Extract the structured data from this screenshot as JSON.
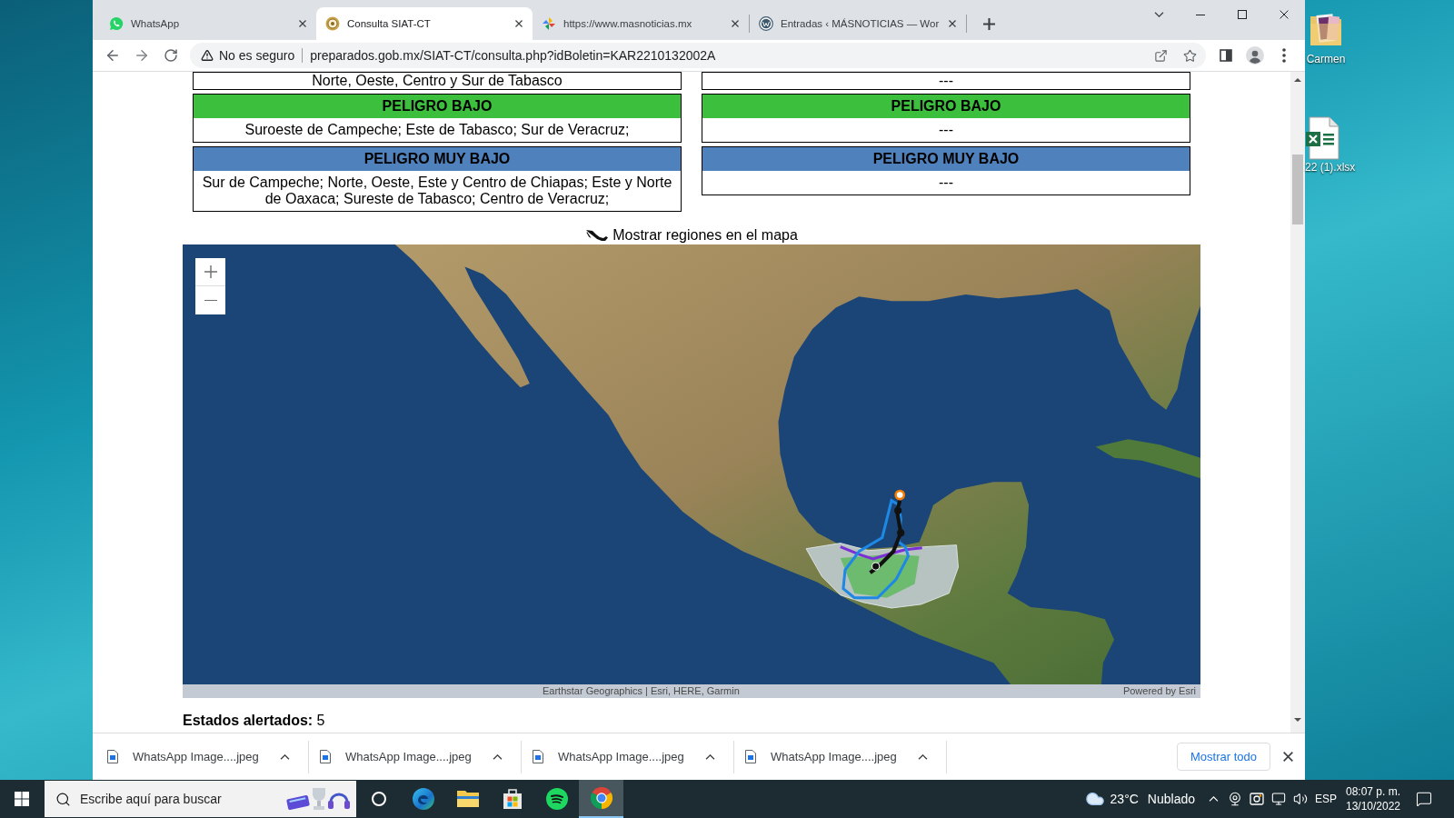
{
  "desktop": {
    "icons": [
      {
        "kind": "folder",
        "label": "Carmen"
      },
      {
        "kind": "spreadsheet",
        "label": "22 (1).xlsx"
      }
    ]
  },
  "browser": {
    "tabs": [
      {
        "kind": "whatsapp",
        "title": "WhatsApp",
        "selected": false
      },
      {
        "kind": "siat",
        "title": "Consulta SIAT-CT",
        "selected": true
      },
      {
        "kind": "masnoticias",
        "title": "https://www.masnoticias.mx",
        "selected": false
      },
      {
        "kind": "wordpress",
        "title": "Entradas ‹ MÁSNOTICIAS — Wor",
        "selected": false
      }
    ],
    "address_bar": {
      "security_label": "No es seguro",
      "url": "preparados.gob.mx/SIAT-CT/consulta.php?idBoletin=KAR2210132002A"
    }
  },
  "page": {
    "alert_columns": [
      {
        "sections": [
          {
            "text": "Norte, Oeste, Centro y Sur de Tabasco"
          },
          {
            "heading": "PELIGRO BAJO",
            "color": "#3cbf3c",
            "text": "Suroeste de Campeche; Este de Tabasco; Sur de Veracruz;"
          },
          {
            "heading": "PELIGRO MUY BAJO",
            "color": "#4f81bd",
            "text": "Sur de Campeche; Norte, Oeste, Este y Centro de Chiapas; Este y Norte de Oaxaca; Sureste de Tabasco; Centro de Veracruz;"
          }
        ]
      },
      {
        "sections": [
          {
            "text": "---"
          },
          {
            "heading": "PELIGRO BAJO",
            "color": "#3cbf3c",
            "text": "---"
          },
          {
            "heading": "PELIGRO MUY BAJO",
            "color": "#4f81bd",
            "text": "---"
          }
        ]
      }
    ],
    "map_toggle": "Mostrar regiones en el mapa",
    "map": {
      "attribution": "Earthstar Geographics | Esri, HERE, Garmin",
      "powered_by": "Powered by Esri"
    },
    "alerted_states": "**Estados alertados:** 5"
  },
  "downloads": {
    "items": [
      {
        "filename": "WhatsApp Image....jpeg"
      },
      {
        "filename": "WhatsApp Image....jpeg"
      },
      {
        "filename": "WhatsApp Image....jpeg"
      },
      {
        "filename": "WhatsApp Image....jpeg"
      }
    ],
    "show_all": "Mostrar todo"
  },
  "taskbar": {
    "search_placeholder": "Escribe aquí para buscar",
    "apps": [
      {
        "kind": "cortana",
        "active": false
      },
      {
        "kind": "edge",
        "active": false
      },
      {
        "kind": "explorer",
        "active": false
      },
      {
        "kind": "store",
        "active": false
      },
      {
        "kind": "spotify",
        "active": false
      },
      {
        "kind": "chrome",
        "active": true
      }
    ],
    "weather": {
      "temperature": "23°C",
      "condition": "Nublado"
    },
    "language": "ESP",
    "time": "08:07 p. m.",
    "date": "13/10/2022"
  }
}
